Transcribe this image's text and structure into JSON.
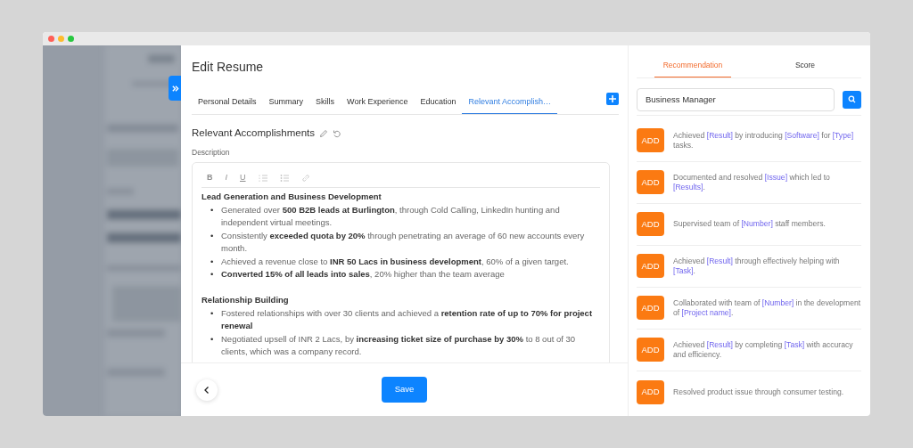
{
  "editor": {
    "title": "Edit Resume",
    "tabs": [
      {
        "label": "Personal Details",
        "selected": false
      },
      {
        "label": "Summary",
        "selected": false
      },
      {
        "label": "Skills",
        "selected": false
      },
      {
        "label": "Work Experience",
        "selected": false
      },
      {
        "label": "Education",
        "selected": false
      },
      {
        "label": "Relevant Accomplish…",
        "selected": true
      }
    ],
    "section_title": "Relevant Accomplishments",
    "field_label": "Description",
    "toolbar": [
      {
        "kind": "bold",
        "label": "B"
      },
      {
        "kind": "italic",
        "label": "I"
      },
      {
        "kind": "underline",
        "label": "U"
      },
      {
        "kind": "ordered-list"
      },
      {
        "kind": "bullet-list"
      },
      {
        "kind": "link"
      }
    ],
    "groups": [
      {
        "heading": "Lead Generation and Business Development",
        "marker": "•",
        "bullets": [
          "Generated over **500 B2B leads at Burlington**, through Cold Calling, LinkedIn hunting and independent virtual meetings.",
          "Consistently **exceeded quota by 20%** through penetrating an average of 60 new accounts every month.",
          "Achieved a revenue close to **INR 50 Lacs in business development**, 60% of a given target.",
          "**Converted 15% of all leads into sales**, 20% higher than the team average"
        ]
      },
      {
        "heading": "Relationship Building",
        "marker": "•",
        "bullets": [
          "Fostered relationships with over 30 clients and achieved a **retention rate of up to 70% for project renewal**",
          "Negotiated upsell of INR 2 Lacs, by **increasing ticket size of purchase by 30%** to 8 out of 30 clients, which was a company record."
        ]
      }
    ],
    "save_button": "Save"
  },
  "side_panel": {
    "tabs": [
      {
        "label": "Recommendation",
        "selected": true
      },
      {
        "label": "Score",
        "selected": false
      }
    ],
    "search": {
      "value": "Business Manager"
    },
    "recommendations": [
      {
        "button": "ADD",
        "parts": [
          {
            "kind": "plain",
            "text": "Achieved "
          },
          {
            "kind": "placeholder",
            "text": "[Result]"
          },
          {
            "kind": "plain",
            "text": " by introducing "
          },
          {
            "kind": "placeholder",
            "text": "[Software]"
          },
          {
            "kind": "plain",
            "text": " for "
          },
          {
            "kind": "placeholder",
            "text": "[Type]"
          },
          {
            "kind": "plain",
            "text": " tasks."
          }
        ]
      },
      {
        "button": "ADD",
        "parts": [
          {
            "kind": "plain",
            "text": "Documented and resolved "
          },
          {
            "kind": "placeholder",
            "text": "[Issue]"
          },
          {
            "kind": "plain",
            "text": " which led to "
          },
          {
            "kind": "placeholder",
            "text": "[Results]"
          },
          {
            "kind": "plain",
            "text": "."
          }
        ]
      },
      {
        "button": "ADD",
        "parts": [
          {
            "kind": "plain",
            "text": "Supervised team of "
          },
          {
            "kind": "placeholder",
            "text": "[Number]"
          },
          {
            "kind": "plain",
            "text": " staff members."
          }
        ]
      },
      {
        "button": "ADD",
        "parts": [
          {
            "kind": "plain",
            "text": "Achieved "
          },
          {
            "kind": "placeholder",
            "text": "[Result]"
          },
          {
            "kind": "plain",
            "text": " through effectively helping with "
          },
          {
            "kind": "placeholder",
            "text": "[Task]"
          },
          {
            "kind": "plain",
            "text": "."
          }
        ]
      },
      {
        "button": "ADD",
        "parts": [
          {
            "kind": "plain",
            "text": "Collaborated with team of "
          },
          {
            "kind": "placeholder",
            "text": "[Number]"
          },
          {
            "kind": "plain",
            "text": " in the development of "
          },
          {
            "kind": "placeholder",
            "text": "[Project name]"
          },
          {
            "kind": "plain",
            "text": "."
          }
        ]
      },
      {
        "button": "ADD",
        "parts": [
          {
            "kind": "plain",
            "text": "Achieved "
          },
          {
            "kind": "placeholder",
            "text": "[Result]"
          },
          {
            "kind": "plain",
            "text": " by completing "
          },
          {
            "kind": "placeholder",
            "text": "[Task]"
          },
          {
            "kind": "plain",
            "text": " with accuracy and efficiency."
          }
        ]
      },
      {
        "button": "ADD",
        "parts": [
          {
            "kind": "plain",
            "text": "Resolved product issue through consumer testing."
          }
        ]
      }
    ]
  }
}
